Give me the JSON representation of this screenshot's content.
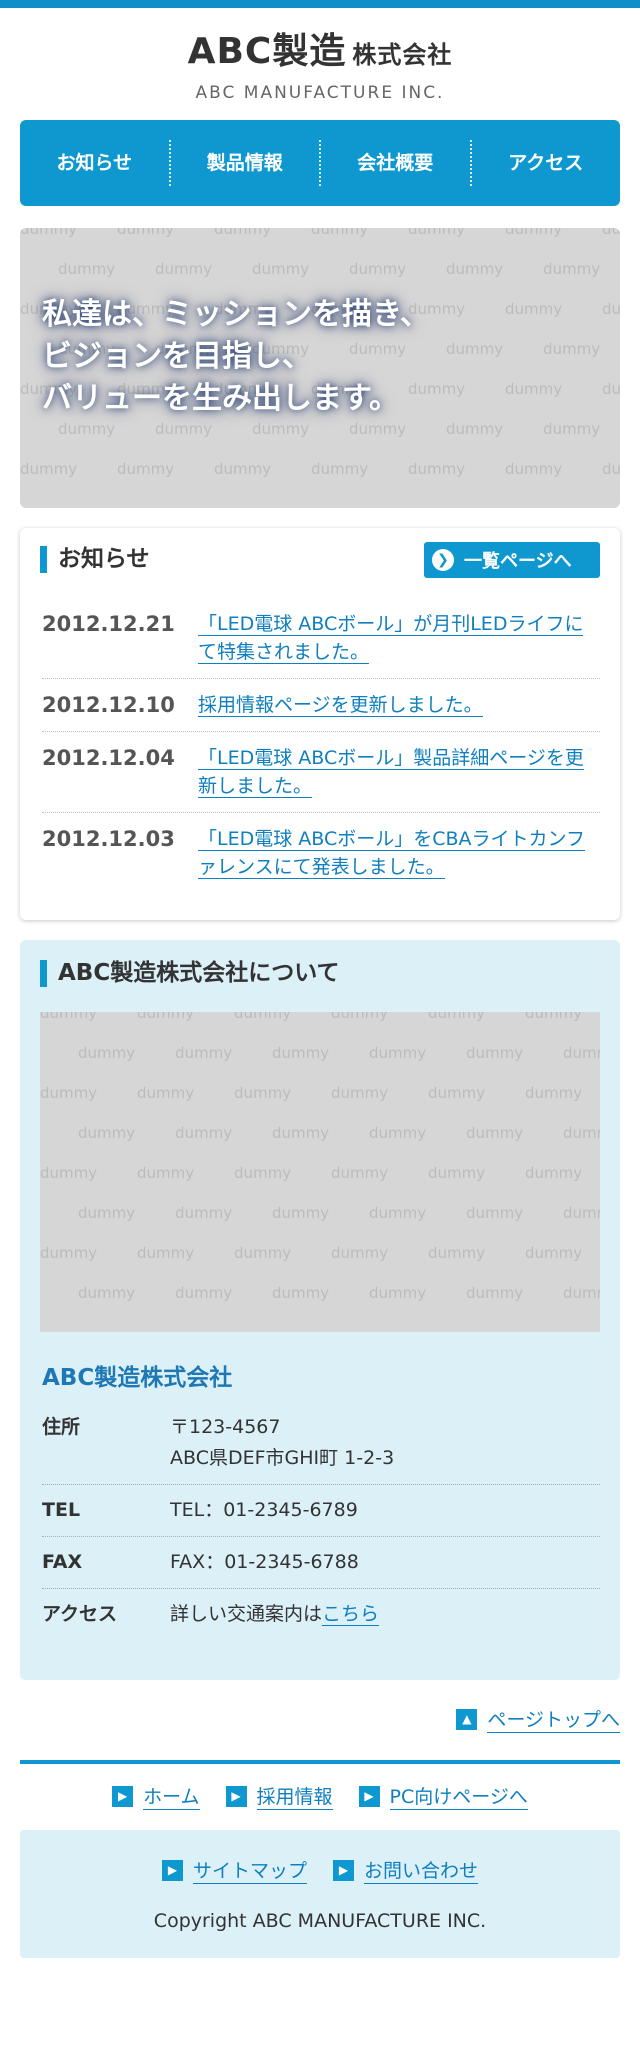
{
  "header": {
    "logo_main": "ABC製造",
    "logo_suffix": "株式会社",
    "logo_sub": "ABC MANUFACTURE INC."
  },
  "nav": {
    "items": [
      {
        "label": "お知らせ"
      },
      {
        "label": "製品情報"
      },
      {
        "label": "会社概要"
      },
      {
        "label": "アクセス"
      }
    ]
  },
  "hero": {
    "placeholder_word": "dummy",
    "lines": [
      "私達は、ミッションを描き、",
      "ビジョンを目指し、",
      "バリューを生み出します。"
    ]
  },
  "news": {
    "title": "お知らせ",
    "more_label": "一覧ページへ",
    "items": [
      {
        "date": "2012.12.21",
        "text": "「LED電球 ABCボール」が月刊LEDライフにて特集されました。"
      },
      {
        "date": "2012.12.10",
        "text": "採用情報ページを更新しました。"
      },
      {
        "date": "2012.12.04",
        "text": "「LED電球 ABCボール」製品詳細ページを更新しました。"
      },
      {
        "date": "2012.12.03",
        "text": "「LED電球 ABCボール」をCBAライトカンファレンスにて発表しました。"
      }
    ]
  },
  "about": {
    "title": "ABC製造株式会社について",
    "placeholder_word": "dummy",
    "company_name": "ABC製造株式会社",
    "rows": [
      {
        "label": "住所",
        "line1": "〒123-4567",
        "line2": "ABC県DEF市GHI町 1-2-3"
      },
      {
        "label": "TEL",
        "line1": "TEL：01-2345-6789"
      },
      {
        "label": "FAX",
        "line1": "FAX：01-2345-6788"
      },
      {
        "label": "アクセス",
        "line1": "詳しい交通案内は",
        "link": "こちら"
      }
    ]
  },
  "pagetop": {
    "label": "ページトップへ"
  },
  "footer": {
    "links": [
      {
        "label": "ホーム"
      },
      {
        "label": "採用情報"
      },
      {
        "label": "PC向けページへ"
      }
    ],
    "links2": [
      {
        "label": "サイトマップ"
      },
      {
        "label": "お問い合わせ"
      }
    ],
    "copyright": "Copyright ABC MANUFACTURE INC."
  },
  "colors": {
    "accent": "#0f98cf",
    "link": "#0f7fbf",
    "light_bg": "#dcf0f8",
    "placeholder_bg": "#d6d6d6"
  }
}
